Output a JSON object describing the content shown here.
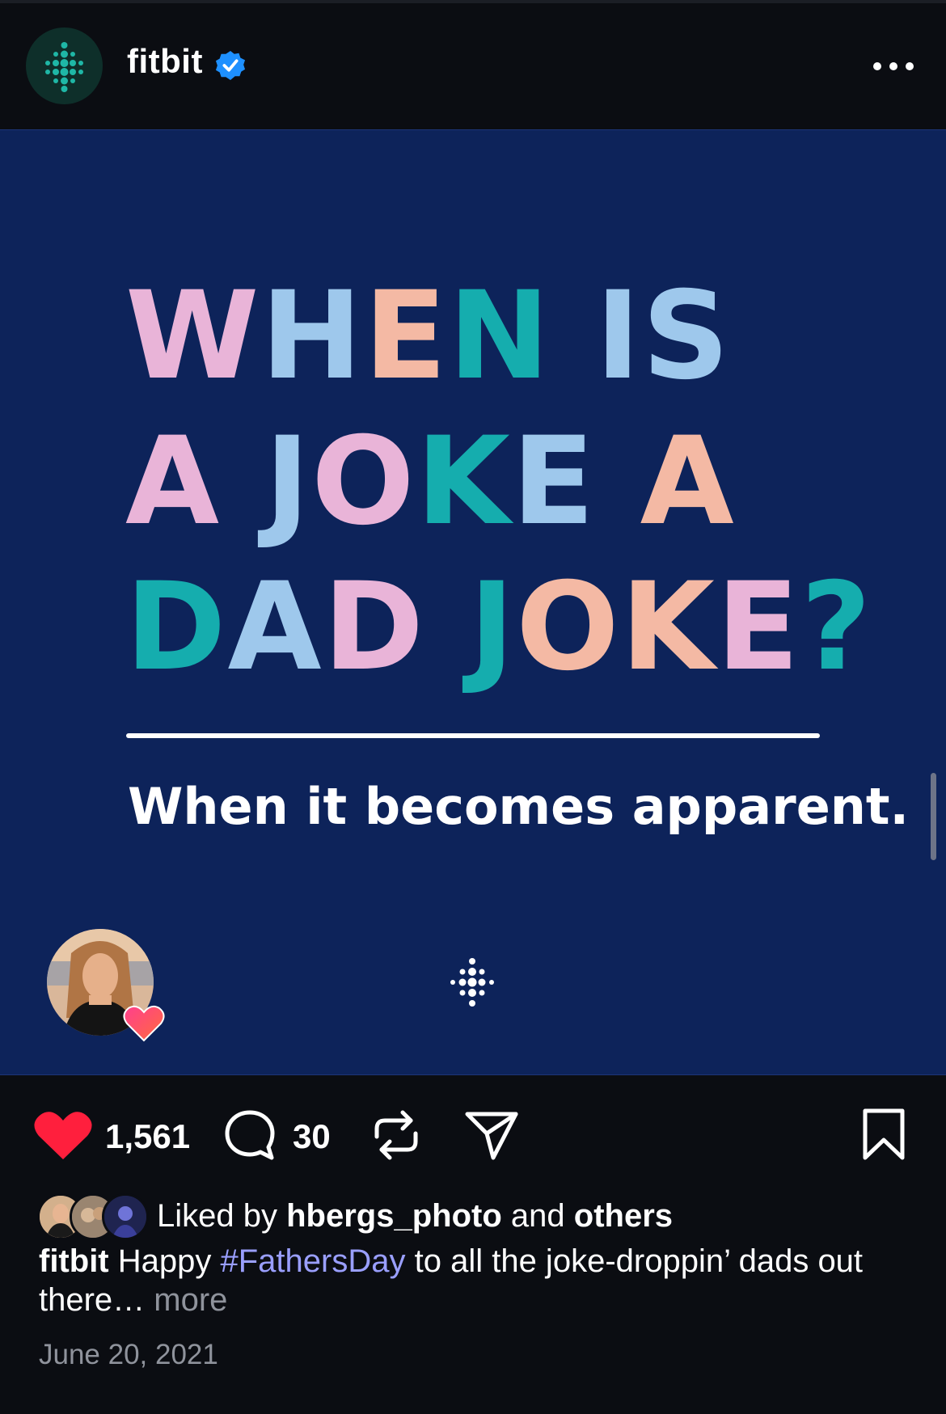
{
  "post": {
    "username": "fitbit",
    "verified_icon": "verified-badge-icon",
    "more_icon": "more-horizontal-icon"
  },
  "image": {
    "headline_lines": [
      "WHEN IS",
      "A JOKE A",
      "DAD JOKE?"
    ],
    "subline": "When it becomes apparent.",
    "colors": {
      "background": "#0d235a",
      "pink": "#e9b4d8",
      "blue": "#9ec8ec",
      "peach": "#f4b9a4",
      "teal": "#15adae"
    }
  },
  "actions": {
    "like_count": "1,561",
    "comment_count": "30",
    "icons": [
      "heart-icon",
      "comment-icon",
      "repost-icon",
      "share-icon",
      "bookmark-icon"
    ]
  },
  "likes": {
    "prefix": "Liked by",
    "user": "hbergs_photo",
    "middle": "and",
    "others": "others"
  },
  "caption": {
    "user": "fitbit",
    "text_before": "Happy",
    "hashtag": "#FathersDay",
    "text_after": "to all the joke-droppin’ dads out there…",
    "more": "more"
  },
  "date": "June 20, 2021"
}
